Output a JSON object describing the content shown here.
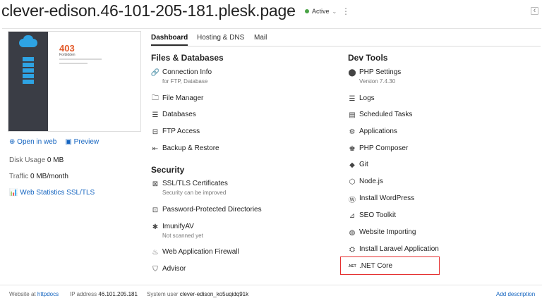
{
  "header": {
    "domain": "clever-edison.46-101-205-181.plesk.page",
    "status": "Active"
  },
  "site": {
    "thumbnail_code": "403",
    "thumbnail_text": "Forbidden",
    "open_in_web": "Open in web",
    "preview": "Preview",
    "disk_usage_label": "Disk Usage",
    "disk_usage_value": "0 MB",
    "traffic_label": "Traffic",
    "traffic_value": "0 MB/month",
    "web_stats": "Web Statistics SSL/TLS"
  },
  "tabs": [
    "Dashboard",
    "Hosting & DNS",
    "Mail"
  ],
  "files_databases": {
    "title": "Files & Databases",
    "items": [
      {
        "label": "Connection Info",
        "sub": "for FTP, Database"
      },
      {
        "label": "File Manager"
      },
      {
        "label": "Databases"
      },
      {
        "label": "FTP Access"
      },
      {
        "label": "Backup & Restore"
      }
    ]
  },
  "security": {
    "title": "Security",
    "items": [
      {
        "label": "SSL/TLS Certificates",
        "sub": "Security can be improved"
      },
      {
        "label": "Password-Protected Directories"
      },
      {
        "label": "ImunifyAV",
        "sub": "Not scanned yet"
      },
      {
        "label": "Web Application Firewall"
      },
      {
        "label": "Advisor"
      }
    ]
  },
  "dev_tools": {
    "title": "Dev Tools",
    "items": [
      {
        "label": "PHP Settings",
        "sub": "Version 7.4.30"
      },
      {
        "label": "Logs"
      },
      {
        "label": "Scheduled Tasks"
      },
      {
        "label": "Applications"
      },
      {
        "label": "PHP Composer"
      },
      {
        "label": "Git"
      },
      {
        "label": "Node.js"
      },
      {
        "label": "Install WordPress"
      },
      {
        "label": "SEO Toolkit"
      },
      {
        "label": "Website Importing"
      },
      {
        "label": "Install Laravel Application"
      },
      {
        "label": ".NET Core",
        "icon_text": ".NET"
      }
    ]
  },
  "footer": {
    "website_at_label": "Website at",
    "website_at_value": "httpdocs",
    "ip_label": "IP address",
    "ip_value": "46.101.205.181",
    "sysuser_label": "System user",
    "sysuser_value": "clever-edison_ko5uqidq91k",
    "add_description": "Add description"
  },
  "colors": {
    "link": "#1565c0",
    "active_status": "#4aa446",
    "highlight_border": "#e53030"
  }
}
